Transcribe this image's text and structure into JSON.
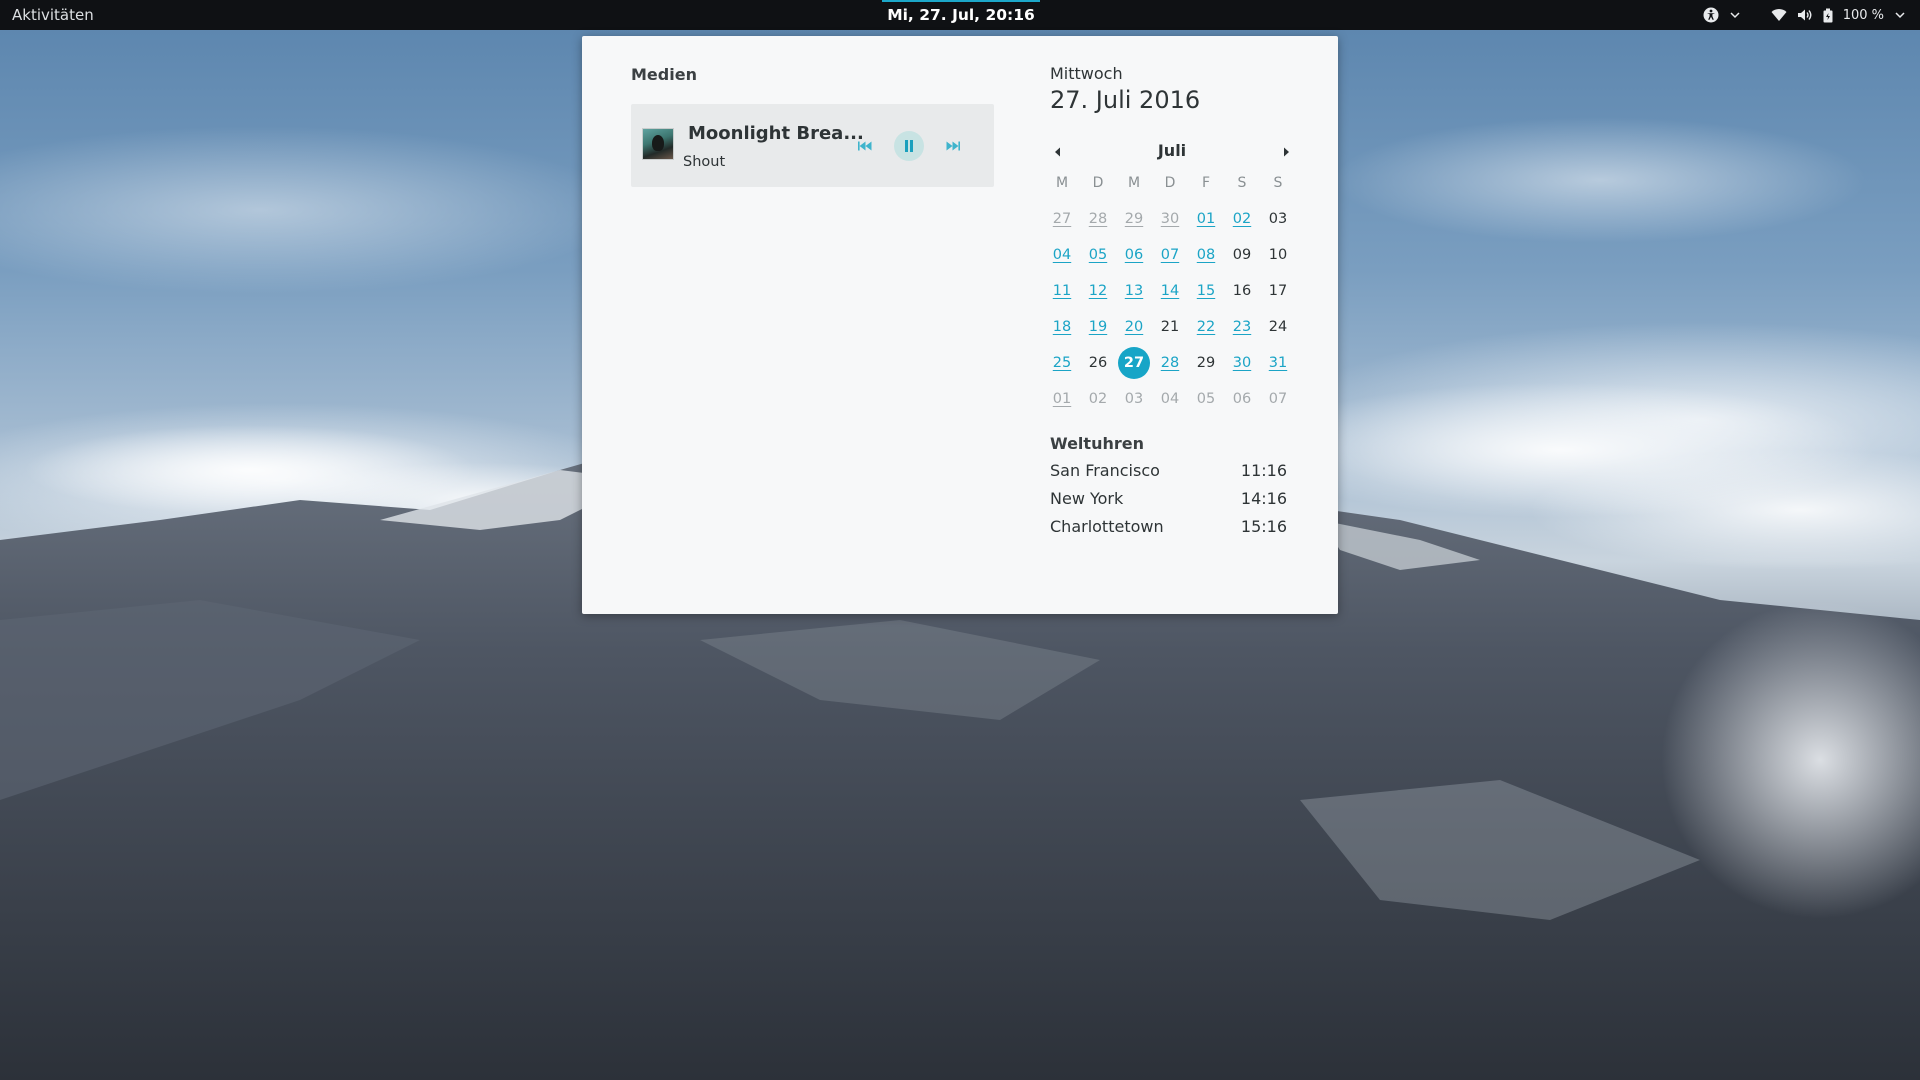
{
  "topbar": {
    "activities": "Aktivitäten",
    "clock": "Mi, 27. Jul, 20:16",
    "battery": "100 %",
    "icons": [
      "accessibility-icon",
      "wifi-icon",
      "volume-icon",
      "battery-icon",
      "chevron-down-icon"
    ]
  },
  "media": {
    "heading": "Medien",
    "track_title": "Moonlight Brea...",
    "artist": "Shout",
    "state": "playing"
  },
  "calendar": {
    "weekday": "Mittwoch",
    "full_date": "27. Juli 2016",
    "month": "Juli",
    "day_headers": [
      "M",
      "D",
      "M",
      "D",
      "F",
      "S",
      "S"
    ],
    "weeks": [
      [
        {
          "d": "27",
          "o": 1,
          "e": 1
        },
        {
          "d": "28",
          "o": 1,
          "e": 1
        },
        {
          "d": "29",
          "o": 1,
          "e": 1
        },
        {
          "d": "30",
          "o": 1,
          "e": 1
        },
        {
          "d": "01",
          "e": 1
        },
        {
          "d": "02",
          "e": 1
        },
        {
          "d": "03"
        }
      ],
      [
        {
          "d": "04",
          "e": 1
        },
        {
          "d": "05",
          "e": 1
        },
        {
          "d": "06",
          "e": 1
        },
        {
          "d": "07",
          "e": 1
        },
        {
          "d": "08",
          "e": 1
        },
        {
          "d": "09"
        },
        {
          "d": "10"
        }
      ],
      [
        {
          "d": "11",
          "e": 1
        },
        {
          "d": "12",
          "e": 1
        },
        {
          "d": "13",
          "e": 1
        },
        {
          "d": "14",
          "e": 1
        },
        {
          "d": "15",
          "e": 1
        },
        {
          "d": "16"
        },
        {
          "d": "17"
        }
      ],
      [
        {
          "d": "18",
          "e": 1
        },
        {
          "d": "19",
          "e": 1
        },
        {
          "d": "20",
          "e": 1
        },
        {
          "d": "21"
        },
        {
          "d": "22",
          "e": 1
        },
        {
          "d": "23",
          "e": 1
        },
        {
          "d": "24"
        }
      ],
      [
        {
          "d": "25",
          "e": 1
        },
        {
          "d": "26"
        },
        {
          "d": "27",
          "t": 1
        },
        {
          "d": "28",
          "e": 1
        },
        {
          "d": "29"
        },
        {
          "d": "30",
          "e": 1
        },
        {
          "d": "31",
          "e": 1
        }
      ],
      [
        {
          "d": "01",
          "o": 1,
          "e": 1
        },
        {
          "d": "02",
          "o": 1
        },
        {
          "d": "03",
          "o": 1
        },
        {
          "d": "04",
          "o": 1
        },
        {
          "d": "05",
          "o": 1
        },
        {
          "d": "06",
          "o": 1
        },
        {
          "d": "07",
          "o": 1
        }
      ]
    ]
  },
  "world_clocks": {
    "heading": "Weltuhren",
    "items": [
      {
        "city": "San Francisco",
        "time": "11:16"
      },
      {
        "city": "New York",
        "time": "14:16"
      },
      {
        "city": "Charlottetown",
        "time": "15:16"
      }
    ]
  },
  "colors": {
    "accent": "#17a5c7",
    "event_link": "#1ba4c6",
    "topbar_bg": "#0f1114",
    "popover_bg": "#f7f8f9"
  }
}
